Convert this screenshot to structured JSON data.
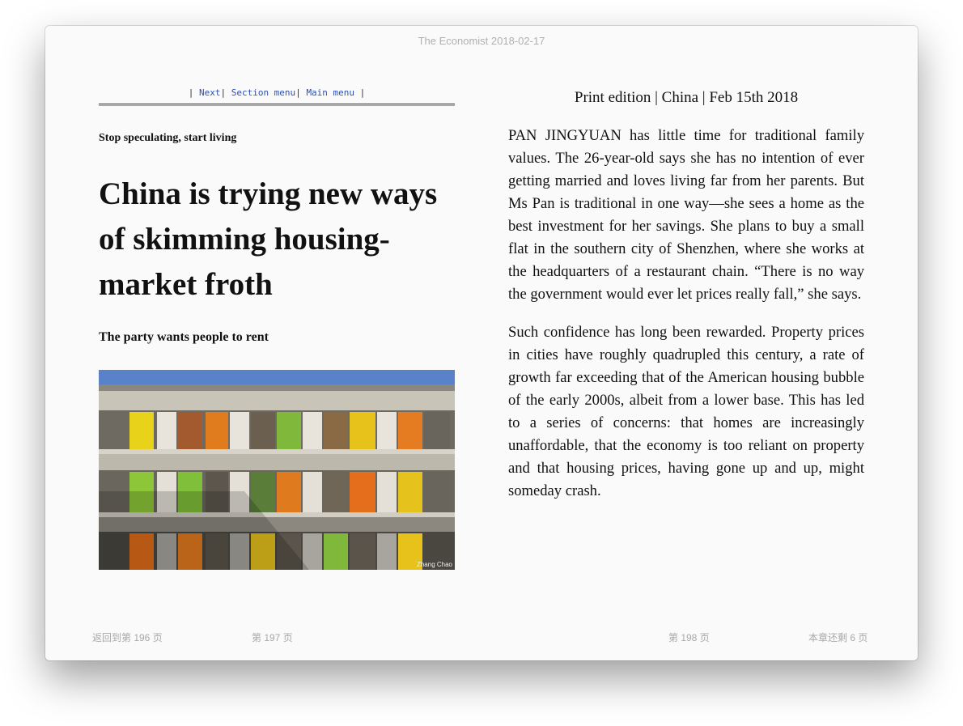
{
  "window": {
    "title": "The Economist 2018-02-17"
  },
  "left_page": {
    "nav": {
      "sep_start": "|",
      "next": "Next",
      "sep1": "|",
      "section_menu": "Section menu",
      "sep2": "|",
      "main_menu": "Main menu",
      "sep_end": "|"
    },
    "fly_title": "Stop speculating, start living",
    "headline": "China is trying new ways of skimming housing-market froth",
    "rubric": "The party wants people to rent",
    "image": {
      "credit": "Zhang Chao"
    }
  },
  "right_page": {
    "dateline": "Print edition | China | Feb 15th 2018",
    "paragraphs": [
      "PAN JINGYUAN has little time for traditional fam­ily values. The 26-year-old says she has no inten­tion of ever getting married and loves living far from her parents. But Ms Pan is traditional in one way—she sees a home as the best investment for her savings. She plans to buy a small flat in the southern city of Shenzhen, where she works at the headquarters of a restaurant chain. “There is no way the government would ever let prices really fall,” she says.",
      "Such confidence has long been rewarded. Property prices in cities have roughly quadrupled this centu­ry, a rate of growth far exceeding that of the Ameri­can housing bubble of the early 2000s, albeit from a lower base. This has led to a series of concerns: that homes are increasingly unaffordable, that the econ­omy is too reliant on property and that housing prices, having gone up and up, might someday crash."
    ]
  },
  "footer": {
    "back_to_page": "返回到第 196 页",
    "left_page_number": "第 197 页",
    "right_page_number": "第 198 页",
    "pages_remaining": "本章还剩 6 页"
  }
}
